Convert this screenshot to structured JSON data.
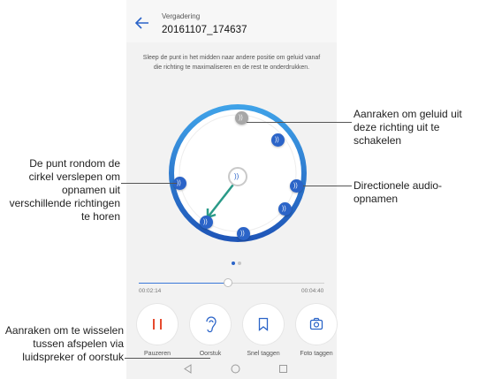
{
  "header": {
    "subtitle": "Vergadering",
    "title": "20161107_174637"
  },
  "instruction": "Sleep de punt in het midden naar andere positie om geluid vanaf die richting te maximaliseren en de rest te onderdrukken.",
  "player": {
    "elapsed": "00:02:14",
    "total": "00:04:40",
    "progress": 0.48
  },
  "controls": [
    {
      "label": "Pauzeren",
      "icon": "pause-icon"
    },
    {
      "label": "Oorstuk",
      "icon": "earpiece-icon"
    },
    {
      "label": "Snel taggen",
      "icon": "bookmark-icon"
    },
    {
      "label": "Foto taggen",
      "icon": "camera-icon"
    }
  ],
  "callouts": {
    "top_right": "Aanraken om geluid uit deze richting uit te schakelen",
    "mid_right": "Directionele audio-opnamen",
    "left": "De punt rondom de cirkel verslepen om opnamen uit verschillende richtingen te horen",
    "bottom_left": "Aanraken om te wisselen tussen afspelen via luidspreker of oorstuk"
  },
  "colors": {
    "accent": "#2b64c8",
    "pause": "#e64a2e",
    "muted_point": "#a7a7a7"
  }
}
